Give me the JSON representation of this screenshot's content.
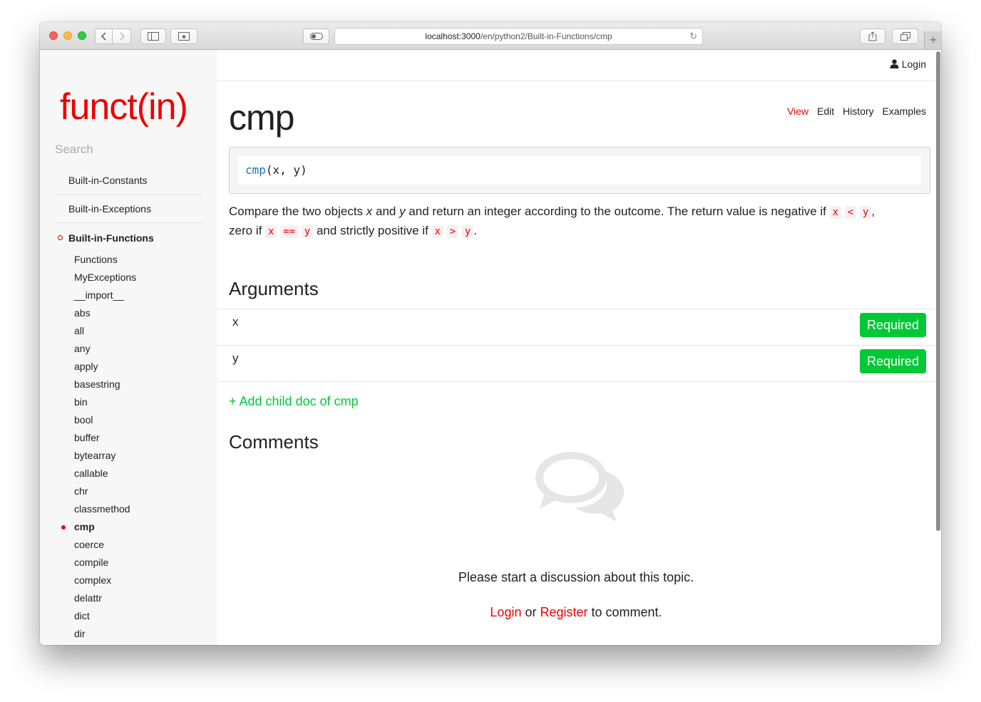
{
  "browser": {
    "url_host": "localhost:3000",
    "url_path": "/en/python2/Built-in-Functions/cmp",
    "icons": {
      "back": "chevron-left-icon",
      "forward": "chevron-right-icon",
      "sidebar": "sidebar-icon",
      "bookmarks": "bookmark-icon",
      "reader": "reader-icon",
      "reload": "reload-icon",
      "share": "share-icon",
      "tabs": "tabs-icon",
      "new_tab": "plus-icon"
    }
  },
  "sidebar": {
    "logo": "funct(in)",
    "search_placeholder": "Search",
    "top_items": [
      {
        "label": "Built-in-Constants"
      },
      {
        "label": "Built-in-Exceptions"
      },
      {
        "label": "Built-in-Functions",
        "active": true
      }
    ],
    "sub_items": [
      {
        "label": "Functions"
      },
      {
        "label": "MyExceptions"
      },
      {
        "label": "__import__"
      },
      {
        "label": "abs"
      },
      {
        "label": "all"
      },
      {
        "label": "any"
      },
      {
        "label": "apply"
      },
      {
        "label": "basestring"
      },
      {
        "label": "bin"
      },
      {
        "label": "bool"
      },
      {
        "label": "buffer"
      },
      {
        "label": "bytearray"
      },
      {
        "label": "callable"
      },
      {
        "label": "chr"
      },
      {
        "label": "classmethod"
      },
      {
        "label": "cmp",
        "current": true
      },
      {
        "label": "coerce"
      },
      {
        "label": "compile"
      },
      {
        "label": "complex"
      },
      {
        "label": "delattr"
      },
      {
        "label": "dict"
      },
      {
        "label": "dir"
      }
    ]
  },
  "header": {
    "login_label": "Login",
    "user_icon": "user-icon"
  },
  "doc": {
    "title": "cmp",
    "tabs": [
      {
        "label": "View",
        "active": true
      },
      {
        "label": "Edit"
      },
      {
        "label": "History"
      },
      {
        "label": "Examples"
      }
    ],
    "signature": {
      "function": "cmp",
      "params": "(x, y)"
    },
    "description": {
      "t1": "Compare the two objects ",
      "v_x": "x",
      "t2": " and ",
      "v_y": "y",
      "t3": " and return an integer according to the outcome. The return value is negative if ",
      "c1": "x",
      "c2": "<",
      "c3": "y",
      "t4": ",",
      "t5": "zero if ",
      "c4": "x",
      "c5": "==",
      "c6": "y",
      "t6": " and strictly positive if ",
      "c7": "x",
      "c8": ">",
      "c9": "y",
      "t7": "."
    },
    "arguments_heading": "Arguments",
    "arguments": [
      {
        "name": "x",
        "badge": "Required"
      },
      {
        "name": "y",
        "badge": "Required"
      }
    ],
    "add_child_label": "+ Add child doc of cmp"
  },
  "comments": {
    "heading": "Comments",
    "icon": "comments-icon",
    "empty_text": "Please start a discussion about this topic.",
    "login_link": "Login",
    "or_text": " or ",
    "register_link": "Register",
    "suffix": " to comment."
  },
  "colors": {
    "accent": "#ee0000",
    "success": "#00c837",
    "sidebar_bg": "#f7f7f7"
  }
}
